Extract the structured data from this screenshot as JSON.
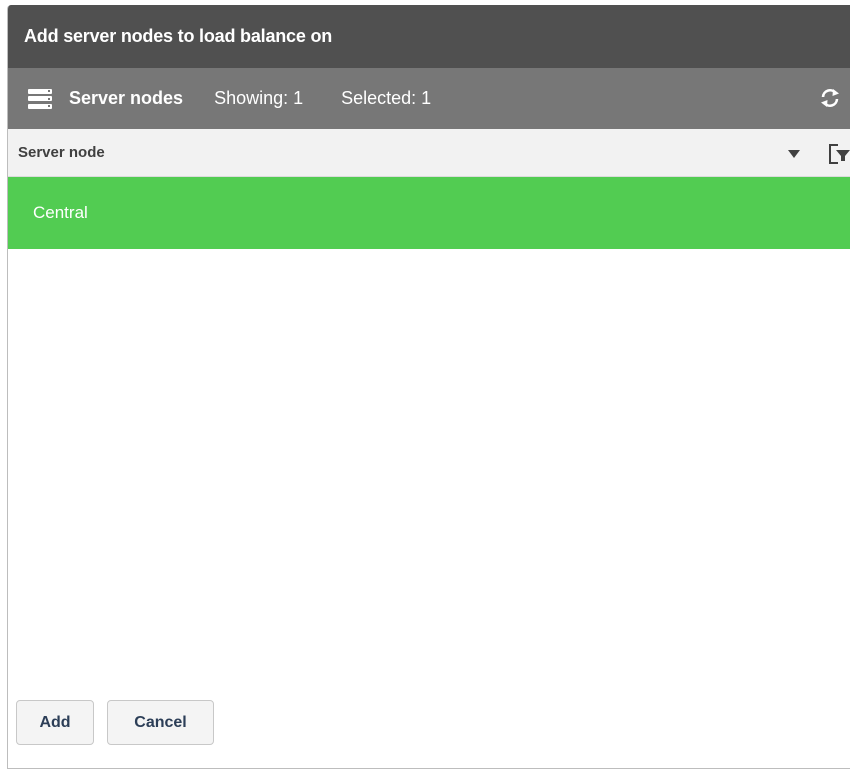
{
  "dialog": {
    "title": "Add server nodes to load balance on"
  },
  "toolbar": {
    "icon": "server-list-icon",
    "section_name": "Server nodes",
    "showing": "Showing: 1",
    "selected": "Selected: 1",
    "refresh_icon": "refresh-icon"
  },
  "table": {
    "columns": [
      {
        "label": "Server node",
        "sort_icon": "sort-descending-icon",
        "filter_icon": "filter-icon"
      }
    ],
    "rows": [
      {
        "server_node": "Central",
        "selected": true
      }
    ],
    "selected_row_color": "#52cc52"
  },
  "footer": {
    "add_label": "Add",
    "cancel_label": "Cancel"
  },
  "colors": {
    "title_bar": "#505050",
    "toolbar": "#777777",
    "header_bg": "#f2f2f2",
    "button_text": "#2c3e57"
  }
}
